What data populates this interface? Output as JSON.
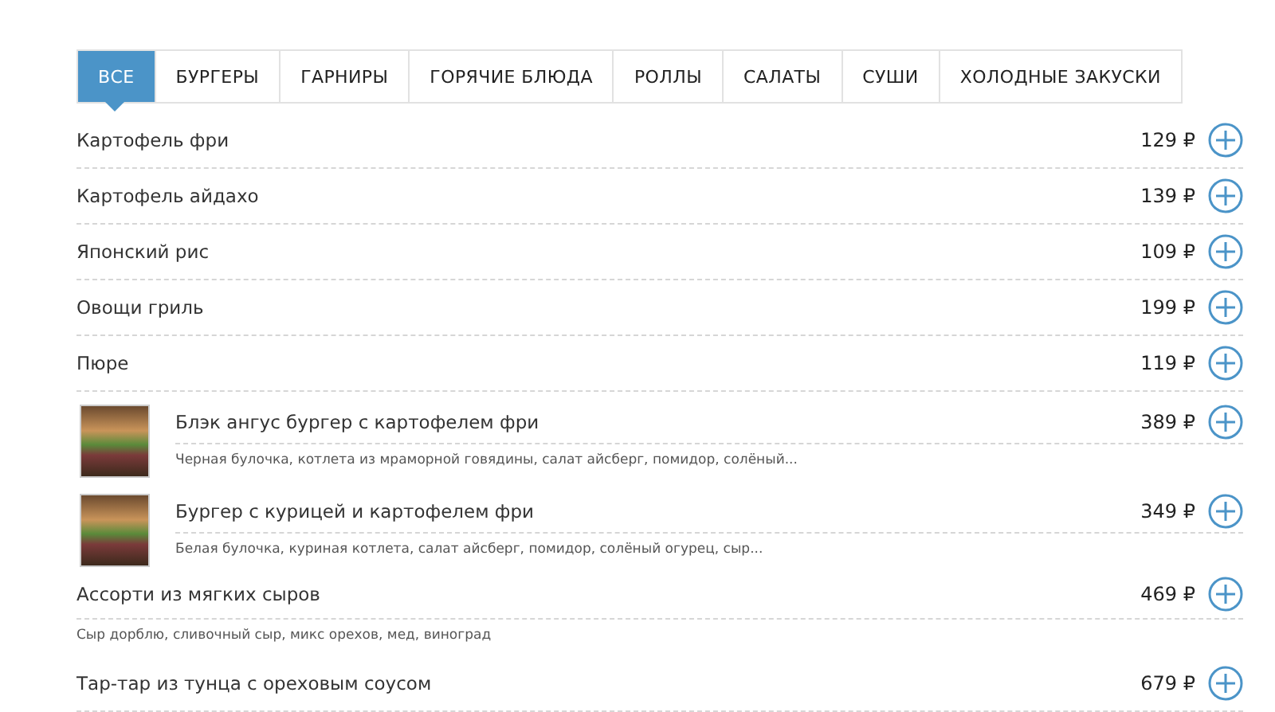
{
  "tabs": [
    {
      "label": "ВСЕ",
      "selected": true
    },
    {
      "label": "БУРГЕРЫ",
      "selected": false
    },
    {
      "label": "ГАРНИРЫ",
      "selected": false
    },
    {
      "label": "ГОРЯЧИЕ БЛЮДА",
      "selected": false
    },
    {
      "label": "РОЛЛЫ",
      "selected": false
    },
    {
      "label": "САЛАТЫ",
      "selected": false
    },
    {
      "label": "СУШИ",
      "selected": false
    },
    {
      "label": "ХОЛОДНЫЕ ЗАКУСКИ",
      "selected": false
    }
  ],
  "items": [
    {
      "kind": "plain",
      "name": "Картофель фри",
      "price": "129 ₽"
    },
    {
      "kind": "plain",
      "name": "Картофель айдахо",
      "price": "139 ₽"
    },
    {
      "kind": "plain",
      "name": "Японский рис",
      "price": "109 ₽"
    },
    {
      "kind": "plain",
      "name": "Овощи гриль",
      "price": "199 ₽"
    },
    {
      "kind": "plain",
      "name": "Пюре",
      "price": "119 ₽"
    },
    {
      "kind": "photo",
      "name": "Блэк ангус бургер с картофелем фри",
      "price": "389 ₽",
      "description": "Черная булочка, котлета из мраморной говядины, салат айсберг, помидор, солёный..."
    },
    {
      "kind": "photo",
      "name": "Бургер с курицей и картофелем фри",
      "price": "349 ₽",
      "description": "Белая булочка, куриная котлета, салат айсберг, помидор, солёный огурец, сыр..."
    },
    {
      "kind": "described",
      "name": "Ассорти из мягких сыров",
      "price": "469 ₽",
      "description": "Сыр дорблю, сливочный сыр, микс орехов, мед, виноград"
    },
    {
      "kind": "plain",
      "name": "Тар-тар из тунца с ореховым соусом",
      "price": "679 ₽"
    }
  ]
}
